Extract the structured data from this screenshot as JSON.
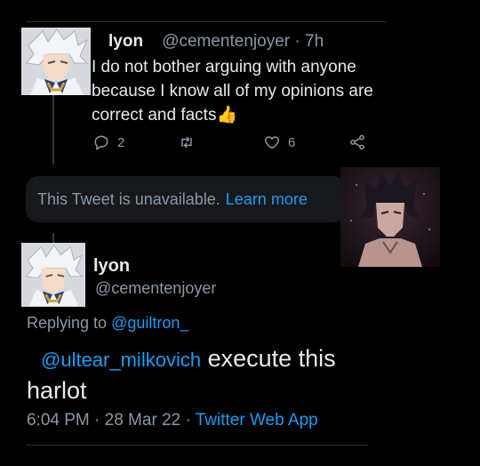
{
  "tweet1": {
    "name": "lyon",
    "handle": "@cementenjoyer",
    "separator": "·",
    "time": "7h",
    "text": "I do not bother arguing with anyone because I know all of my opinions are correct and facts",
    "emoji": "👍",
    "reply_count": "2",
    "like_count": "6"
  },
  "unavailable": {
    "text": "This Tweet is unavailable.",
    "link": "Learn more"
  },
  "tweet2": {
    "name": "lyon",
    "handle": "@cementenjoyer",
    "replying_prefix": "Replying to",
    "replying_handle": "@guiltron_",
    "mention": "@ultear_milkovich",
    "text": "execute this harlot",
    "timestamp": "6:04 PM · 28 Mar 22 ·",
    "app": "Twitter Web App"
  },
  "colors": {
    "background": "#000000",
    "text": "#e7e9ea",
    "muted": "#8b98a5",
    "link": "#1d9bf0",
    "card": "#16181c"
  },
  "icons": {
    "reply": "reply-icon",
    "retweet": "retweet-icon",
    "like": "heart-icon",
    "share": "share-icon"
  }
}
